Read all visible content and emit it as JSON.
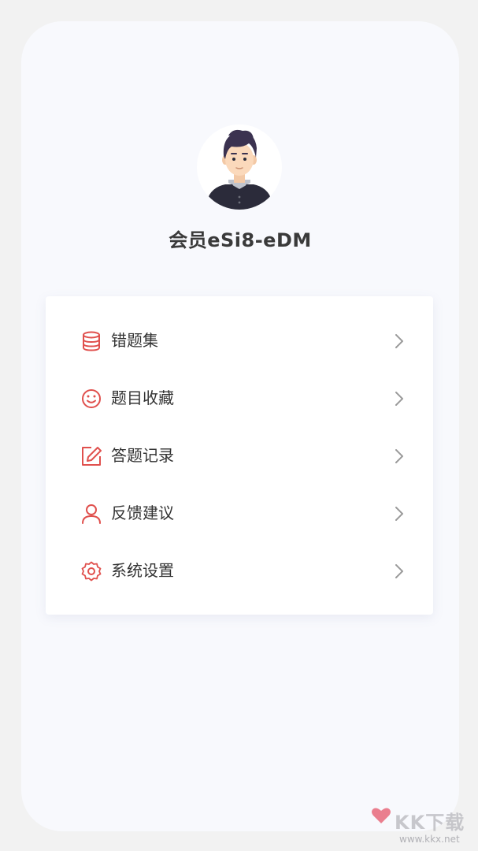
{
  "profile": {
    "username": "会员eSi8-eDM",
    "avatar_icon": "male-user-avatar"
  },
  "menu": {
    "items": [
      {
        "label": "错题集",
        "icon": "database-icon"
      },
      {
        "label": "题目收藏",
        "icon": "smile-icon"
      },
      {
        "label": "答题记录",
        "icon": "edit-icon"
      },
      {
        "label": "反馈建议",
        "icon": "user-icon"
      },
      {
        "label": "系统设置",
        "icon": "settings-icon"
      }
    ],
    "chevron_icon": "chevron-right-icon"
  },
  "watermark": {
    "brand": "KK下载",
    "url": "www.kkx.net"
  },
  "colors": {
    "accent": "#e0504d",
    "background": "#f8f9fd",
    "card": "#ffffff",
    "text": "#333333",
    "chevron": "#9a9a9a"
  }
}
